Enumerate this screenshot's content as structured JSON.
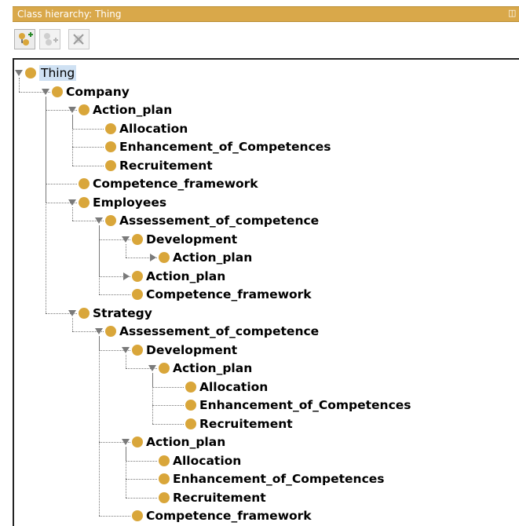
{
  "panel": {
    "title": "Class hierarchy: Thing"
  },
  "toolbar": {
    "buttons": [
      {
        "name": "add-subclass-icon"
      },
      {
        "name": "add-sibling-icon"
      },
      {
        "name": "delete-class-icon"
      }
    ]
  },
  "tree": {
    "nodes": [
      {
        "id": "n0",
        "label": "Thing",
        "depth": 0,
        "expander": "down",
        "root": true
      },
      {
        "id": "n1",
        "label": "Company",
        "depth": 1,
        "expander": "down"
      },
      {
        "id": "n2",
        "label": "Action_plan",
        "depth": 2,
        "expander": "down"
      },
      {
        "id": "n3",
        "label": "Allocation",
        "depth": 3,
        "expander": "none"
      },
      {
        "id": "n4",
        "label": "Enhancement_of_Competences",
        "depth": 3,
        "expander": "none"
      },
      {
        "id": "n5",
        "label": "Recruitement",
        "depth": 3,
        "expander": "none"
      },
      {
        "id": "n6",
        "label": "Competence_framework",
        "depth": 2,
        "expander": "none"
      },
      {
        "id": "n7",
        "label": "Employees",
        "depth": 2,
        "expander": "down"
      },
      {
        "id": "n8",
        "label": "Assessement_of_competence",
        "depth": 3,
        "expander": "down"
      },
      {
        "id": "n9",
        "label": "Development",
        "depth": 4,
        "expander": "down"
      },
      {
        "id": "n10",
        "label": "Action_plan",
        "depth": 5,
        "expander": "right"
      },
      {
        "id": "n11",
        "label": "Action_plan",
        "depth": 4,
        "expander": "right"
      },
      {
        "id": "n12",
        "label": "Competence_framework",
        "depth": 4,
        "expander": "none"
      },
      {
        "id": "n13",
        "label": "Strategy",
        "depth": 2,
        "expander": "down"
      },
      {
        "id": "n14",
        "label": "Assessement_of_competence",
        "depth": 3,
        "expander": "down"
      },
      {
        "id": "n15",
        "label": "Development",
        "depth": 4,
        "expander": "down"
      },
      {
        "id": "n16",
        "label": "Action_plan",
        "depth": 5,
        "expander": "down"
      },
      {
        "id": "n17",
        "label": "Allocation",
        "depth": 6,
        "expander": "none"
      },
      {
        "id": "n18",
        "label": "Enhancement_of_Competences",
        "depth": 6,
        "expander": "none"
      },
      {
        "id": "n19",
        "label": "Recruitement",
        "depth": 6,
        "expander": "none"
      },
      {
        "id": "n20",
        "label": "Action_plan",
        "depth": 4,
        "expander": "down"
      },
      {
        "id": "n21",
        "label": "Allocation",
        "depth": 5,
        "expander": "none"
      },
      {
        "id": "n22",
        "label": "Enhancement_of_Competences",
        "depth": 5,
        "expander": "none"
      },
      {
        "id": "n23",
        "label": "Recruitement",
        "depth": 5,
        "expander": "none"
      },
      {
        "id": "n24",
        "label": "Competence_framework",
        "depth": 4,
        "expander": "none"
      }
    ]
  },
  "colors": {
    "titlebar": "#d9a84a",
    "class_dot": "#d9a63a",
    "selection": "#cfe1f3"
  }
}
